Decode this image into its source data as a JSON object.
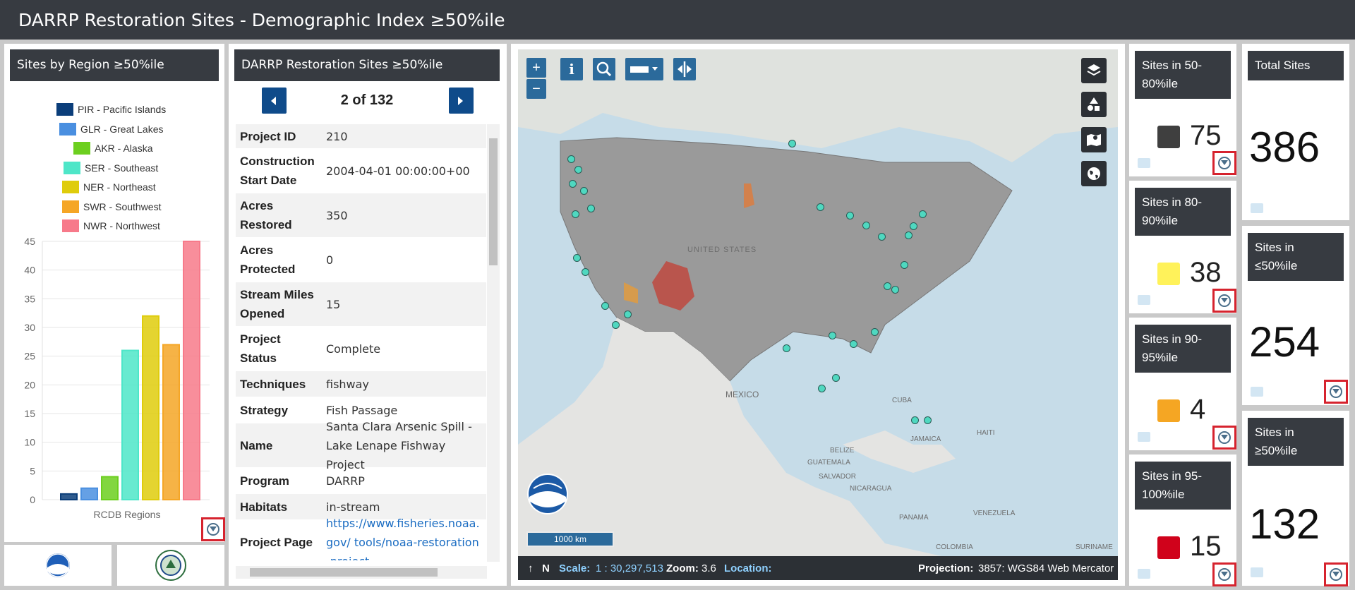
{
  "app": {
    "title": "DARRP Restoration Sites - Demographic Index ≥50%ile"
  },
  "region_panel": {
    "title": "Sites by Region ≥50%ile",
    "legend": [
      {
        "label": "PIR - Pacific Islands",
        "color": "#0b3e7a"
      },
      {
        "label": "GLR - Great Lakes",
        "color": "#4a8fe0"
      },
      {
        "label": "AKR - Alaska",
        "color": "#6ccf1f"
      },
      {
        "label": "SER - Southeast",
        "color": "#4ee6c8"
      },
      {
        "label": "NER - Northeast",
        "color": "#dfcc0c"
      },
      {
        "label": "SWR - Southwest",
        "color": "#f5a626"
      },
      {
        "label": "NWR - Northwest",
        "color": "#f77a8a"
      }
    ]
  },
  "chart_data": {
    "type": "bar",
    "categories": [
      "PIR - Pacific Islands",
      "GLR - Great Lakes",
      "AKR - Alaska",
      "SER - Southeast",
      "NER - Northeast",
      "SWR - Southwest",
      "NWR - Northwest"
    ],
    "values": [
      1,
      2,
      4,
      26,
      32,
      27,
      45
    ],
    "colors": [
      "#0b3e7a",
      "#4a8fe0",
      "#6ccf1f",
      "#4ee6c8",
      "#dfcc0c",
      "#f5a626",
      "#f77a8a"
    ],
    "xlabel": "RCDB Regions",
    "ylabel": "",
    "yticks": [
      "0",
      "5",
      "10",
      "15",
      "20",
      "25",
      "30",
      "35",
      "40",
      "45"
    ],
    "ylim": [
      0,
      45
    ],
    "grid": true,
    "legend": "top"
  },
  "details_panel": {
    "title": "DARRP Restoration Sites ≥50%ile",
    "pager": "2 of 132",
    "rows": [
      {
        "key": "Project ID",
        "value": "210"
      },
      {
        "key": "Construction Start Date",
        "value": "2004-04-01 00:00:00+00"
      },
      {
        "key": "Acres Restored",
        "value": "350"
      },
      {
        "key": "Acres Protected",
        "value": "0"
      },
      {
        "key": "Stream Miles Opened",
        "value": "15"
      },
      {
        "key": "Project Status",
        "value": "Complete"
      },
      {
        "key": "Techniques",
        "value": "fishway"
      },
      {
        "key": "Strategy",
        "value": "Fish Passage"
      },
      {
        "key": "Name",
        "value": "Santa Clara Arsenic Spill - Lake Lenape Fishway Project"
      },
      {
        "key": "Program",
        "value": "DARRP"
      },
      {
        "key": "Habitats",
        "value": "in-stream"
      },
      {
        "key": "Project Page",
        "value": "https://www.fisheries.noaa.gov/ tools/noaa-restoration-project"
      }
    ]
  },
  "map": {
    "zoom_in": "+",
    "zoom_out": "−",
    "labels": [
      "UNITED STATES",
      "MEXICO",
      "CUBA",
      "HAITI",
      "JAMAICA",
      "BELIZE",
      "GUATEMALA",
      "SALVADOR",
      "NICARAGUA",
      "PANAMA",
      "VENEZUELA",
      "COLOMBIA",
      "SURINAME"
    ],
    "scale_bar": "1000 km",
    "status": {
      "north": "N",
      "scale_label": "Scale:",
      "scale_value": "1 : 30,297,513",
      "zoom_label": "Zoom:",
      "zoom_value": "3.6",
      "location_label": "Location:",
      "projection_label": "Projection:",
      "projection_value": "3857: WGS84 Web Mercator"
    }
  },
  "cards": {
    "c50": {
      "title": "Sites in 50-80%ile",
      "value": "75",
      "color": "#3f3f3f"
    },
    "c80": {
      "title": "Sites in 80-90%ile",
      "value": "38",
      "color": "#fff25a"
    },
    "c90": {
      "title": "Sites in 90-95%ile",
      "value": "4",
      "color": "#f5a623"
    },
    "c95": {
      "title": "Sites in 95-100%ile",
      "value": "15",
      "color": "#d0021b"
    },
    "total": {
      "title": "Total Sites",
      "value": "386"
    },
    "le50": {
      "title": "Sites in ≤50%ile",
      "value": "254"
    },
    "ge50": {
      "title": "Sites in ≥50%ile",
      "value": "132"
    }
  }
}
